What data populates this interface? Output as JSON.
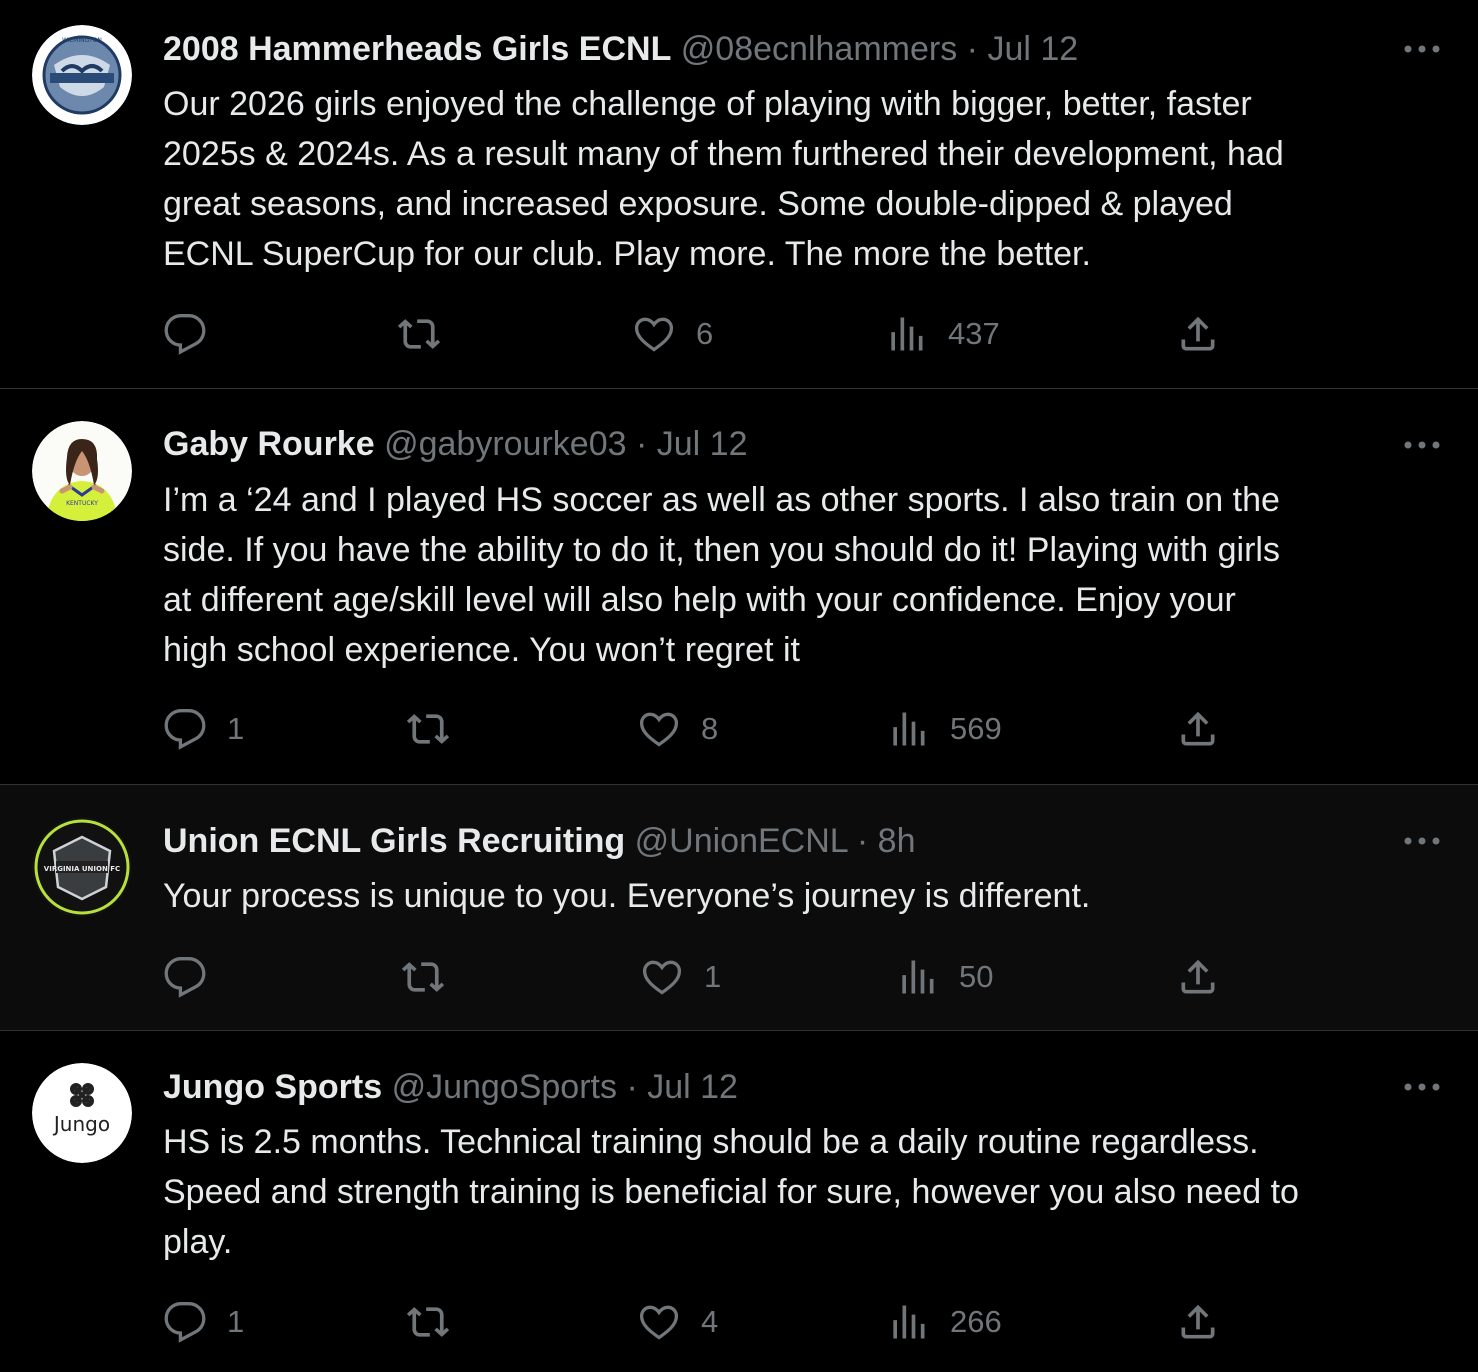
{
  "colors": {
    "background": "#000000",
    "text": "#e7e9ea",
    "muted": "#71767b",
    "divider": "#2f3336"
  },
  "tweets": [
    {
      "name": "2008 Hammerheads Girls ECNL",
      "handle": "@08ecnlhammers",
      "separator": "·",
      "time": "Jul 12",
      "text": "Our 2026 girls enjoyed the challenge of playing with bigger, better, faster\n2025s & 2024s. As a result many of them furthered their development, had\ngreat seasons, and increased exposure. Some double-dipped & played\nECNL SuperCup for our club. Play more. The more the better.",
      "avatar_text": "WILMINGTON",
      "replies": "",
      "retweets": "",
      "likes": "6",
      "views": "437"
    },
    {
      "name": "Gaby Rourke",
      "handle": "@gabyrourke03",
      "separator": "·",
      "time": "Jul 12",
      "text": "I’m a ‘24 and I played HS soccer as well as other sports. I also train on the\nside. If you have the ability to do it, then you should do it! Playing with girls\nat different age/skill level will also help with your confidence. Enjoy your\nhigh school experience. You won’t regret it",
      "avatar_text": "KENTUCKY",
      "replies": "1",
      "retweets": "",
      "likes": "8",
      "views": "569"
    },
    {
      "name": "Union ECNL Girls Recruiting",
      "handle": "@UnionECNL",
      "separator": "·",
      "time": "8h",
      "text": "Your process is unique to you. Everyone’s journey is different.",
      "avatar_text": "VIRGINIA UNION FC",
      "replies": "",
      "retweets": "",
      "likes": "1",
      "views": "50"
    },
    {
      "name": "Jungo Sports",
      "handle": "@JungoSports",
      "separator": "·",
      "time": "Jul 12",
      "text": "HS is 2.5 months. Technical training should be a daily routine regardless.\nSpeed and strength training is beneficial for sure, however you also need to\nplay.",
      "avatar_text": "Jungo",
      "replies": "1",
      "retweets": "",
      "likes": "4",
      "views": "266"
    }
  ],
  "icons": {
    "reply": "reply-icon",
    "retweet": "retweet-icon",
    "like": "like-icon",
    "views": "views-icon",
    "share": "share-icon",
    "more": "more-icon"
  }
}
